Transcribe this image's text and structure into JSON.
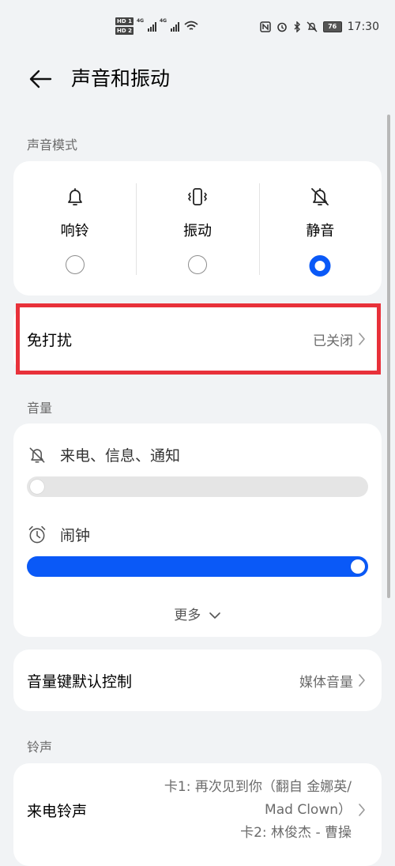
{
  "status_bar": {
    "hd1": "HD 1",
    "hd2": "HD 2",
    "net1": "4G",
    "net2": "4G",
    "battery": "76",
    "time": "17:30"
  },
  "header": {
    "title": "声音和振动"
  },
  "sound_mode": {
    "label": "声音模式",
    "options": [
      {
        "label": "响铃",
        "icon": "bell-icon",
        "selected": false
      },
      {
        "label": "振动",
        "icon": "vibrate-icon",
        "selected": false
      },
      {
        "label": "静音",
        "icon": "bell-off-icon",
        "selected": true
      }
    ]
  },
  "dnd": {
    "title": "免打扰",
    "value": "已关闭"
  },
  "volume": {
    "label": "音量",
    "calls_label": "来电、信息、通知",
    "calls_level": 0,
    "alarm_label": "闹钟",
    "alarm_level": 100,
    "more": "更多"
  },
  "volume_key": {
    "title": "音量键默认控制",
    "value": "媒体音量"
  },
  "ringtone": {
    "label": "铃声",
    "title": "来电铃声",
    "value_line1": "卡1: 再次见到你（翻自 金娜英/",
    "value_line2": "Mad Clown）",
    "value_line3": "卡2: 林俊杰 - 曹操"
  },
  "colors": {
    "accent": "#0a59f7",
    "highlight": "#e8313a",
    "background": "#f1f3f5"
  }
}
